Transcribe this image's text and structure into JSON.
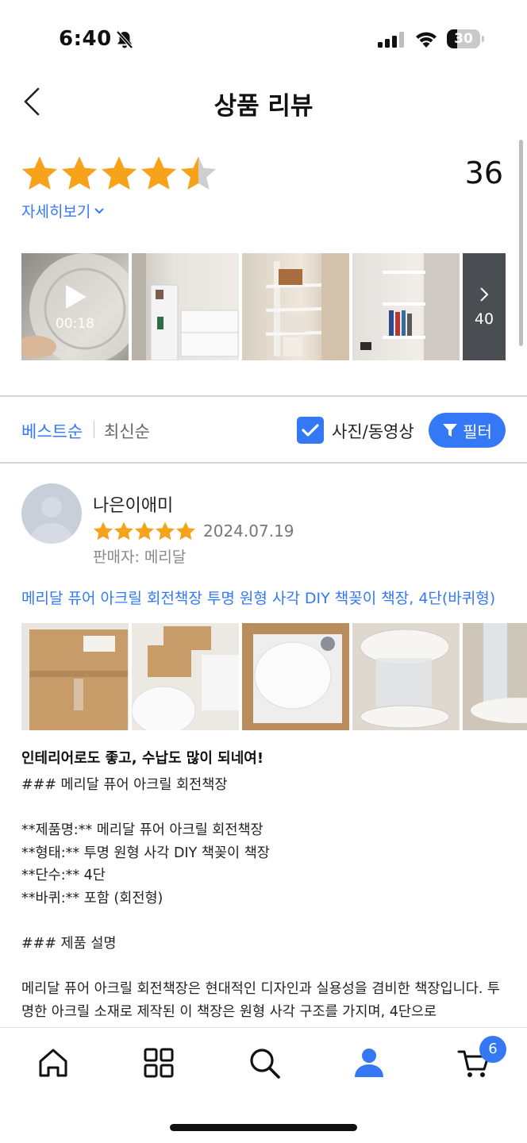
{
  "status_bar": {
    "time": "6:40",
    "battery": "30"
  },
  "header": {
    "title": "상품 리뷰"
  },
  "summary": {
    "rating": 4.5,
    "review_count": "36",
    "detail_link": "자세히보기"
  },
  "photos": {
    "video_duration": "00:18",
    "more_count": "40"
  },
  "sort": {
    "best": "베스트순",
    "newest": "최신순",
    "photo_video": "사진/동영상",
    "filter": "필터"
  },
  "review": {
    "reviewer": "나은이애미",
    "rating": 5,
    "date": "2024.07.19",
    "seller": "판매자: 메리달",
    "product": "메리달 퓨어 아크릴 회전책장 투명 원형 사각 DIY 책꽂이 책장, 4단(바퀴형)",
    "title": "인테리어로도 좋고, 수납도 많이 되네여!",
    "body": "### 메리달 퓨어 아크릴 회전책장\n\n**제품명:** 메리달 퓨어 아크릴 회전책장\n**형태:** 투명 원형 사각 DIY 책꽂이 책장\n**단수:** 4단\n**바퀴:** 포함 (회전형)\n\n### 제품 설명\n\n메리달 퓨어 아크릴 회전책장은 현대적인 디자인과 실용성을 겸비한 책장입니다. 투명한 아크릴 소재로 제작된 이 책장은 원형 사각 구조를 가지며, 4단으로"
  },
  "bottom_nav": {
    "cart_badge": "6"
  },
  "colors": {
    "accent": "#3478f6",
    "star": "#f7a21b",
    "star_empty": "#cfcfcf"
  }
}
